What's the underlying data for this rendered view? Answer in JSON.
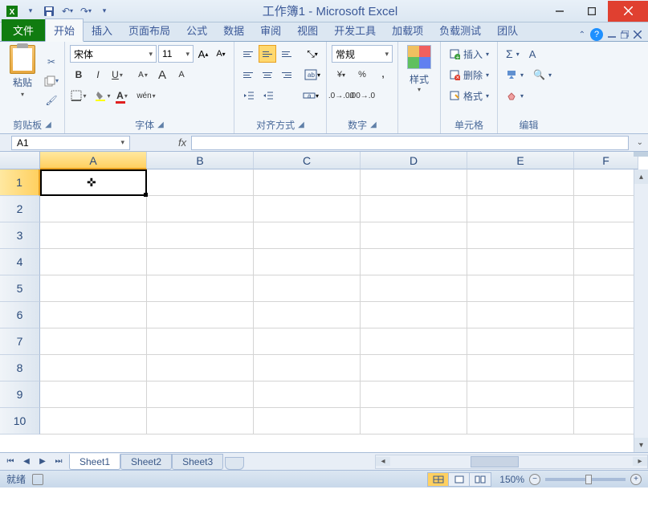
{
  "title": {
    "doc": "工作簿1",
    "app": "Microsoft Excel"
  },
  "tabs": {
    "file": "文件",
    "list": [
      "开始",
      "插入",
      "页面布局",
      "公式",
      "数据",
      "审阅",
      "视图",
      "开发工具",
      "加载项",
      "负载测试",
      "团队"
    ],
    "active": 0
  },
  "ribbon": {
    "clipboard": {
      "label": "剪贴板",
      "paste": "粘贴"
    },
    "font": {
      "label": "字体",
      "name": "宋体",
      "size": "11"
    },
    "alignment": {
      "label": "对齐方式"
    },
    "number": {
      "label": "数字",
      "format": "常规"
    },
    "styles": {
      "label": "样式",
      "btn": "样式"
    },
    "cells": {
      "label": "单元格",
      "insert": "插入",
      "delete": "删除",
      "format": "格式"
    },
    "editing": {
      "label": "编辑"
    }
  },
  "formula": {
    "cell": "A1"
  },
  "grid": {
    "cols": [
      "A",
      "B",
      "C",
      "D",
      "E",
      "F"
    ],
    "rows": [
      "1",
      "2",
      "3",
      "4",
      "5",
      "6",
      "7",
      "8",
      "9",
      "10"
    ]
  },
  "sheets": {
    "list": [
      "Sheet1",
      "Sheet2",
      "Sheet3"
    ],
    "active": 0
  },
  "status": {
    "ready": "就绪",
    "zoom": "150%"
  }
}
